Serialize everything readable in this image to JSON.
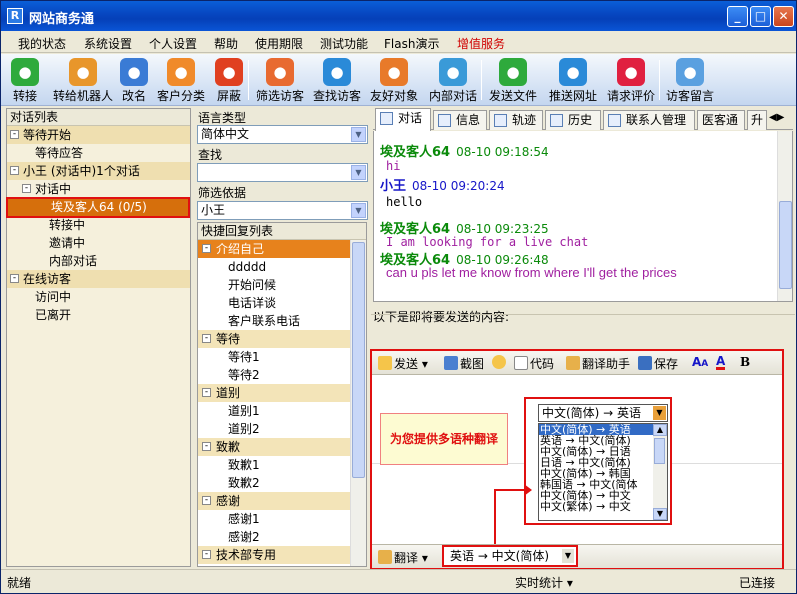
{
  "window": {
    "title": "网站商务通",
    "app_icon": "R"
  },
  "menu": [
    "我的状态",
    "系统设置",
    "个人设置",
    "帮助",
    "使用期限",
    "测试功能",
    "Flash演示",
    "增值服务"
  ],
  "toolbar": [
    {
      "label": "转接",
      "icon": "transfer-icon",
      "color": "#2eaa3c"
    },
    {
      "label": "转给机器人",
      "icon": "robot-icon",
      "color": "#e8962b"
    },
    {
      "label": "改名",
      "icon": "rename-icon",
      "color": "#3a7bd5"
    },
    {
      "label": "客户分类",
      "icon": "group-icon",
      "color": "#f08a2a"
    },
    {
      "label": "屏蔽",
      "icon": "block-icon",
      "color": "#e04020"
    },
    {
      "label": "筛选访客",
      "icon": "filter-visitor-icon",
      "color": "#e86a30"
    },
    {
      "label": "查找访客",
      "icon": "search-visitor-icon",
      "color": "#2a8ad8"
    },
    {
      "label": "友好对象",
      "icon": "friend-icon",
      "color": "#e87a2a"
    },
    {
      "label": "内部对话",
      "icon": "internal-chat-icon",
      "color": "#3a9ad8"
    },
    {
      "label": "发送文件",
      "icon": "send-file-icon",
      "color": "#2eaa3c"
    },
    {
      "label": "推送网址",
      "icon": "push-url-icon",
      "color": "#2a8ad8"
    },
    {
      "label": "请求评价",
      "icon": "rating-icon",
      "color": "#e02040"
    },
    {
      "label": "访客留言",
      "icon": "message-icon",
      "color": "#5aa0e0"
    }
  ],
  "left_panel": {
    "title": "对话列表",
    "items": [
      {
        "label": "等待开始",
        "level": 0,
        "group": true,
        "box": "-"
      },
      {
        "label": "等待应答",
        "level": 1,
        "group": false
      },
      {
        "label": "小王 (对话中)1个对话",
        "level": 0,
        "group": true,
        "box": "-"
      },
      {
        "label": "对话中",
        "level": 1,
        "group": false,
        "box": "-"
      },
      {
        "label": "埃及客人64 (0/5)",
        "level": 2,
        "group": false,
        "selected": true
      },
      {
        "label": "转接中",
        "level": 2,
        "group": false
      },
      {
        "label": "邀请中",
        "level": 2,
        "group": false
      },
      {
        "label": "内部对话",
        "level": 2,
        "group": false
      },
      {
        "label": "在线访客",
        "level": 0,
        "group": true,
        "box": "-"
      },
      {
        "label": "访问中",
        "level": 1,
        "group": false
      },
      {
        "label": "已离开",
        "level": 1,
        "group": false
      }
    ]
  },
  "mid_panel": {
    "lang_type_label": "语言类型",
    "lang_type_value": "简体中文",
    "search_label": "查找",
    "search_value": "",
    "filter_label": "筛选依据",
    "filter_value": "小王",
    "quick_title": "快捷回复列表",
    "quick_items": [
      {
        "label": "介绍自己",
        "group": true,
        "hi": true
      },
      {
        "label": "ddddd",
        "group": false
      },
      {
        "label": "开始问候",
        "group": false
      },
      {
        "label": "电话详谈",
        "group": false
      },
      {
        "label": "客户联系电话",
        "group": false
      },
      {
        "label": "等待",
        "group": true
      },
      {
        "label": "等待1",
        "group": false
      },
      {
        "label": "等待2",
        "group": false
      },
      {
        "label": "道别",
        "group": true
      },
      {
        "label": "道别1",
        "group": false
      },
      {
        "label": "道别2",
        "group": false
      },
      {
        "label": "致歉",
        "group": true
      },
      {
        "label": "致歉1",
        "group": false
      },
      {
        "label": "致歉2",
        "group": false
      },
      {
        "label": "感谢",
        "group": true
      },
      {
        "label": "感谢1",
        "group": false
      },
      {
        "label": "感谢2",
        "group": false
      },
      {
        "label": "技术部专用",
        "group": true
      }
    ]
  },
  "tabs": [
    "对话",
    "信息",
    "轨迹",
    "历史",
    "联系人管理",
    "医客通",
    "升"
  ],
  "chat": [
    {
      "name": "埃及客人64",
      "time": "08-10 09:18:54",
      "text": "hi",
      "who": "visitor"
    },
    {
      "name": "小王",
      "time": "08-10 09:20:24",
      "text": "hello",
      "who": "agent"
    },
    {
      "name": "埃及客人64",
      "time": "08-10 09:23:25",
      "text": "I am looking for a live chat",
      "who": "visitor"
    },
    {
      "name": "埃及客人64",
      "time": "08-10 09:26:48",
      "text": "can u pls let me know from where I'll get the prices",
      "who": "visitor2"
    }
  ],
  "send_label": "以下是即将要发送的内容:",
  "compose_toolbar": [
    "发送",
    "截图",
    "代码",
    "翻译助手",
    "保存",
    "A",
    "A",
    "B"
  ],
  "callout": "为您提供多语种翻译",
  "lang_combo_value": "中文(简体) → 英语",
  "lang_options": [
    "中文(简体) → 英语",
    "英语 → 中文(简体)",
    "中文(简体) → 日语",
    "日语 → 中文(简体)",
    "中文(简体) → 韩国",
    "韩国语 → 中文(简体",
    "中文(简体) → 中文",
    "中文(繁体) → 中文"
  ],
  "translate_label": "翻译",
  "translate_value": "英语 → 中文(简体)",
  "status": {
    "left": "就绪",
    "mid": "实时统计",
    "right": "已连接"
  }
}
